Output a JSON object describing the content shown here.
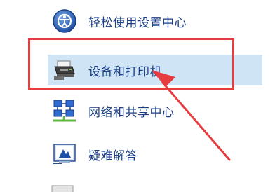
{
  "panel": {
    "items": [
      {
        "label": "轻松使用设置中心",
        "icon": "ease-of-access-icon"
      },
      {
        "label": "设备和打印机",
        "icon": "printer-icon"
      },
      {
        "label": "网络和共享中心",
        "icon": "network-icon"
      },
      {
        "label": "疑难解答",
        "icon": "troubleshooting-icon"
      }
    ],
    "next_item_icon": "control-panel-item-icon"
  },
  "annotation": {
    "highlight_color": "#e63b3f",
    "highlight_target": "devices-and-printers",
    "arrow_color": "#e63b3f"
  },
  "colors": {
    "link_text": "#1a3f86",
    "selected_row": "#cfe4f5",
    "background": "#ffffff"
  }
}
